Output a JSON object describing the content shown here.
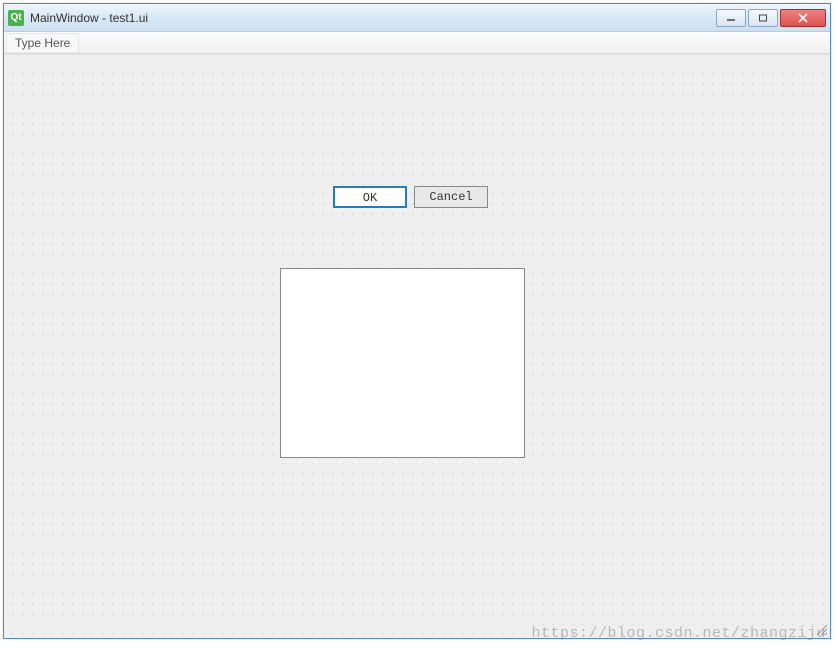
{
  "window": {
    "app_icon_label": "Qt",
    "title": "MainWindow - test1.ui"
  },
  "menubar": {
    "placeholder": "Type Here"
  },
  "buttons": {
    "ok_label": "OK",
    "cancel_label": "Cancel"
  },
  "watermark": "https://blog.csdn.net/zhangziju"
}
